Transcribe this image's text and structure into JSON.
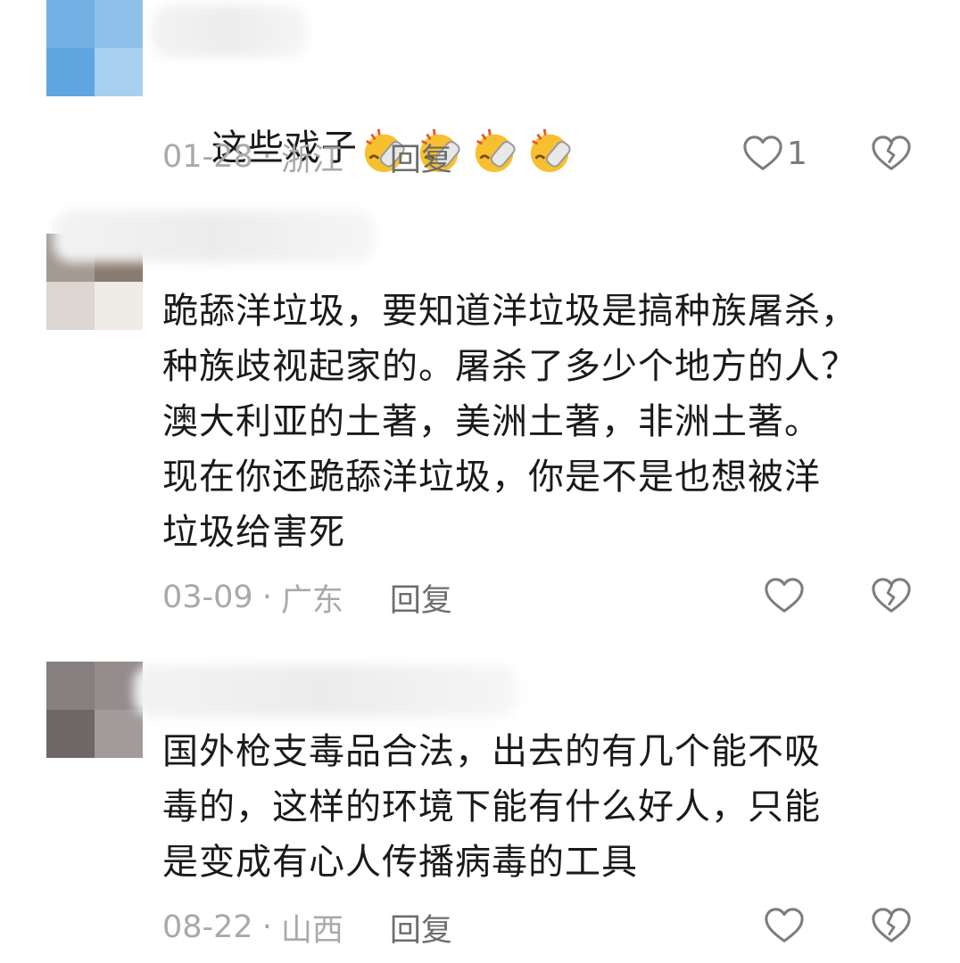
{
  "comments": [
    {
      "text": "这些戏子",
      "emoji": "party-popper-face-icon",
      "emoji_count": 4,
      "date": "01-28",
      "region": "浙江",
      "reply_label": "回复",
      "likes": "1"
    },
    {
      "text": "跪舔洋垃圾，要知道洋垃圾是搞种族屠杀，\n种族歧视起家的。屠杀了多少个地方的人？\n澳大利亚的土著，美洲土著，非洲土著。\n现在你还跪舔洋垃圾，你是不是也想被洋\n垃圾给害死",
      "date": "03-09",
      "region": "广东",
      "reply_label": "回复",
      "likes": ""
    },
    {
      "text": "国外枪支毒品合法，出去的有几个能不吸\n毒的，这样的环境下能有什么好人，只能\n是变成有心人传播病毒的工具",
      "date": "08-22",
      "region": "山西",
      "reply_label": "回复",
      "likes": ""
    }
  ],
  "separator": "·",
  "colors": {
    "meta": "#a9a9a9",
    "reply": "#6d6d6d",
    "text": "#1a1a1a",
    "icon": "#7d7d7d",
    "avatar1": "#7fb6e6",
    "avatar2": "#8c7d74",
    "avatar3": "#7f7979"
  }
}
